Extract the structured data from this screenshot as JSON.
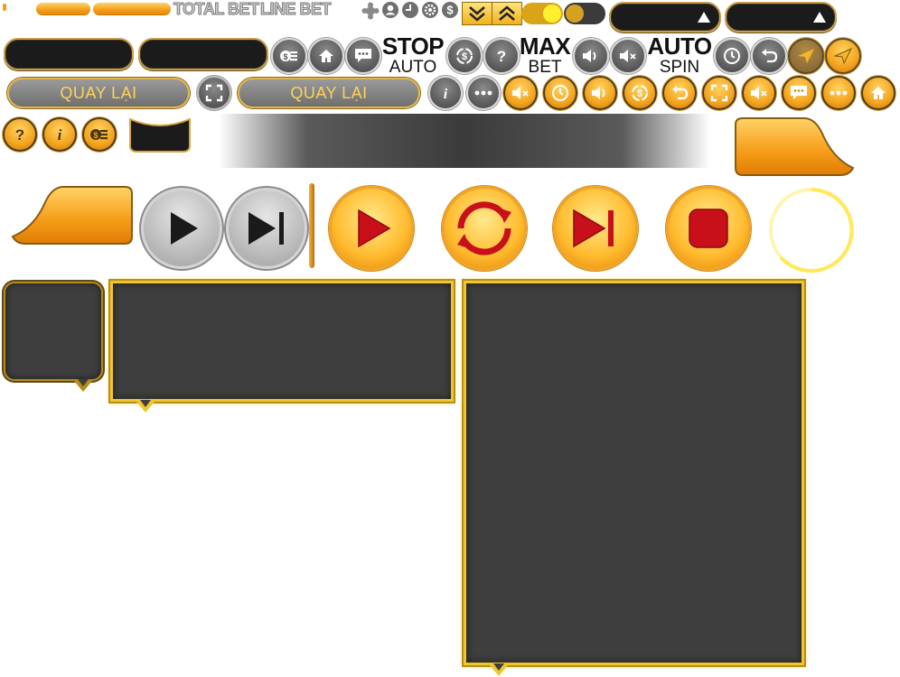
{
  "labels": {
    "total_bet": "TOTAL BET",
    "line_bet": "LINE BET"
  },
  "buttons": {
    "quay_lai_1": "QUAY LẠI",
    "quay_lai_2": "QUAY LẠI",
    "stop_big": "STOP",
    "stop_small": "AUTO",
    "max_big": "MAX",
    "max_small": "BET",
    "auto_big": "AUTO",
    "auto_small": "SPIN"
  },
  "icons": {
    "row2": [
      "coins-icon",
      "home-icon",
      "chat-icon",
      "paytable-icon",
      "help-icon",
      "sound-on-icon",
      "sound-off-icon",
      "history-icon",
      "undo-icon",
      "arrow-left-icon",
      "arrow-left-icon"
    ],
    "row3": [
      "fullscreen-icon",
      "info-icon",
      "more-icon",
      "sound-off-icon",
      "history-icon",
      "sound-on-icon",
      "paytable-icon",
      "undo-icon",
      "fullscreen-icon",
      "sound-off-icon",
      "chat-icon",
      "more-icon",
      "home-icon"
    ],
    "row4": [
      "help-icon",
      "info-icon",
      "coins-icon"
    ]
  },
  "colors": {
    "gold": "#f1c62c",
    "orange": "#f39a16",
    "panel": "#3e3e3e",
    "red": "#c8101a"
  }
}
